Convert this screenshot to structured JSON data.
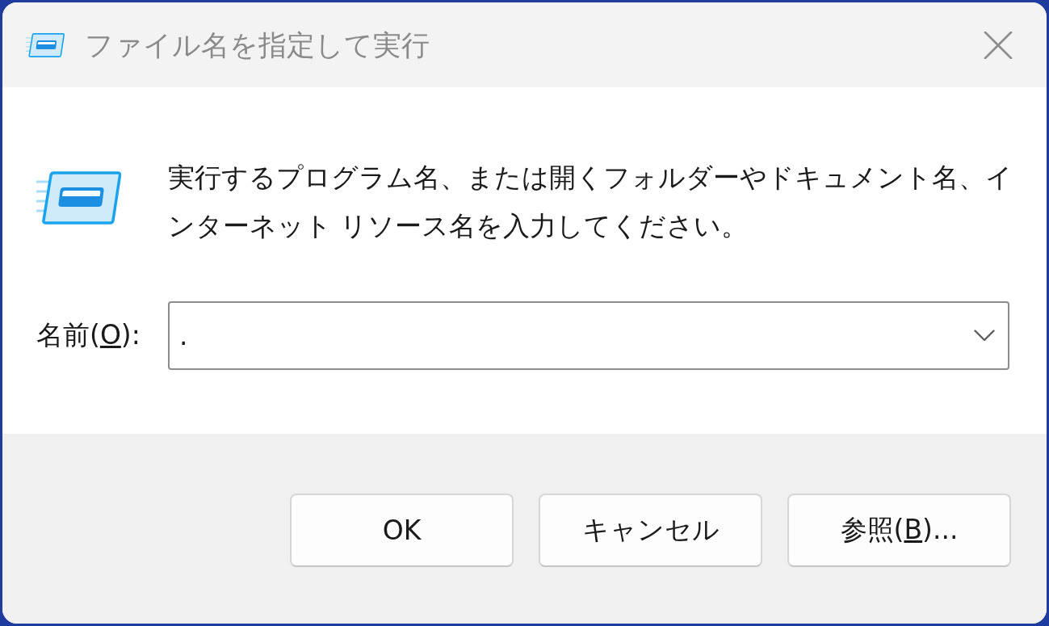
{
  "window": {
    "title": "ファイル名を指定して実行",
    "focused": false
  },
  "description": "実行するプログラム名、または開くフォルダーやドキュメント名、インターネット リソース名を入力してください。",
  "name_field": {
    "label": {
      "before": "名前(",
      "access_key": "O",
      "after": "):"
    },
    "value": "."
  },
  "buttons": [
    {
      "label": {
        "before": "OK"
      }
    },
    {
      "label": {
        "before": "キャンセル"
      }
    },
    {
      "label": {
        "before": "参照(",
        "access_key": "B",
        "after": ")..."
      }
    }
  ]
}
